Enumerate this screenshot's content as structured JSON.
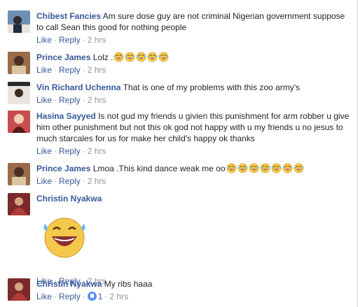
{
  "comments": [
    {
      "name": "Chibest Fancies",
      "text": "Am sure dose guy are not criminal Nigerian government suppose to call Sean this good for nothing people",
      "like": "Like",
      "reply": "Reply",
      "time": "2 hrs"
    },
    {
      "name": "Prince James",
      "text": "Lolz .",
      "emoji_icon": "laughing-tears-emoji",
      "emoji_count": 5,
      "like": "Like",
      "reply": "Reply",
      "time": "2 hrs"
    },
    {
      "name": "Vin Richard Uchenna",
      "text": "That is one of my problems with this zoo army's",
      "like": "Like",
      "reply": "Reply",
      "time": "2 hrs"
    },
    {
      "name": "Hasina Sayyed",
      "text": "Is not gud my friends u givien this punishment for arm robber u give him other punishment but not this ok god not happy with u my friends u no jesus to much starcales for us for make her child's happy ok thanks",
      "like": "Like",
      "reply": "Reply",
      "time": "2 hrs"
    },
    {
      "name": "Prince James",
      "text": "Lmoa .This kind dance weak me oo",
      "emoji_icon": "laughing-tears-emoji",
      "emoji_count": 7,
      "like": "Like",
      "reply": "Reply",
      "time": "2 hrs"
    },
    {
      "name": "Christin Nyakwa",
      "text": "",
      "sticker_icon": "laughing-sticker",
      "like": "Like",
      "reply": "Reply",
      "time": "2 hrs"
    },
    {
      "name": "Christin Nyakwa",
      "text": "My ribs haaa",
      "like": "Like",
      "reply": "Reply",
      "reaction_count": "1",
      "time": "2 hrs"
    }
  ],
  "colors": {
    "name": "#365899",
    "text": "#1d2129",
    "meta": "#90949c",
    "like_badge": "#5890ff"
  }
}
